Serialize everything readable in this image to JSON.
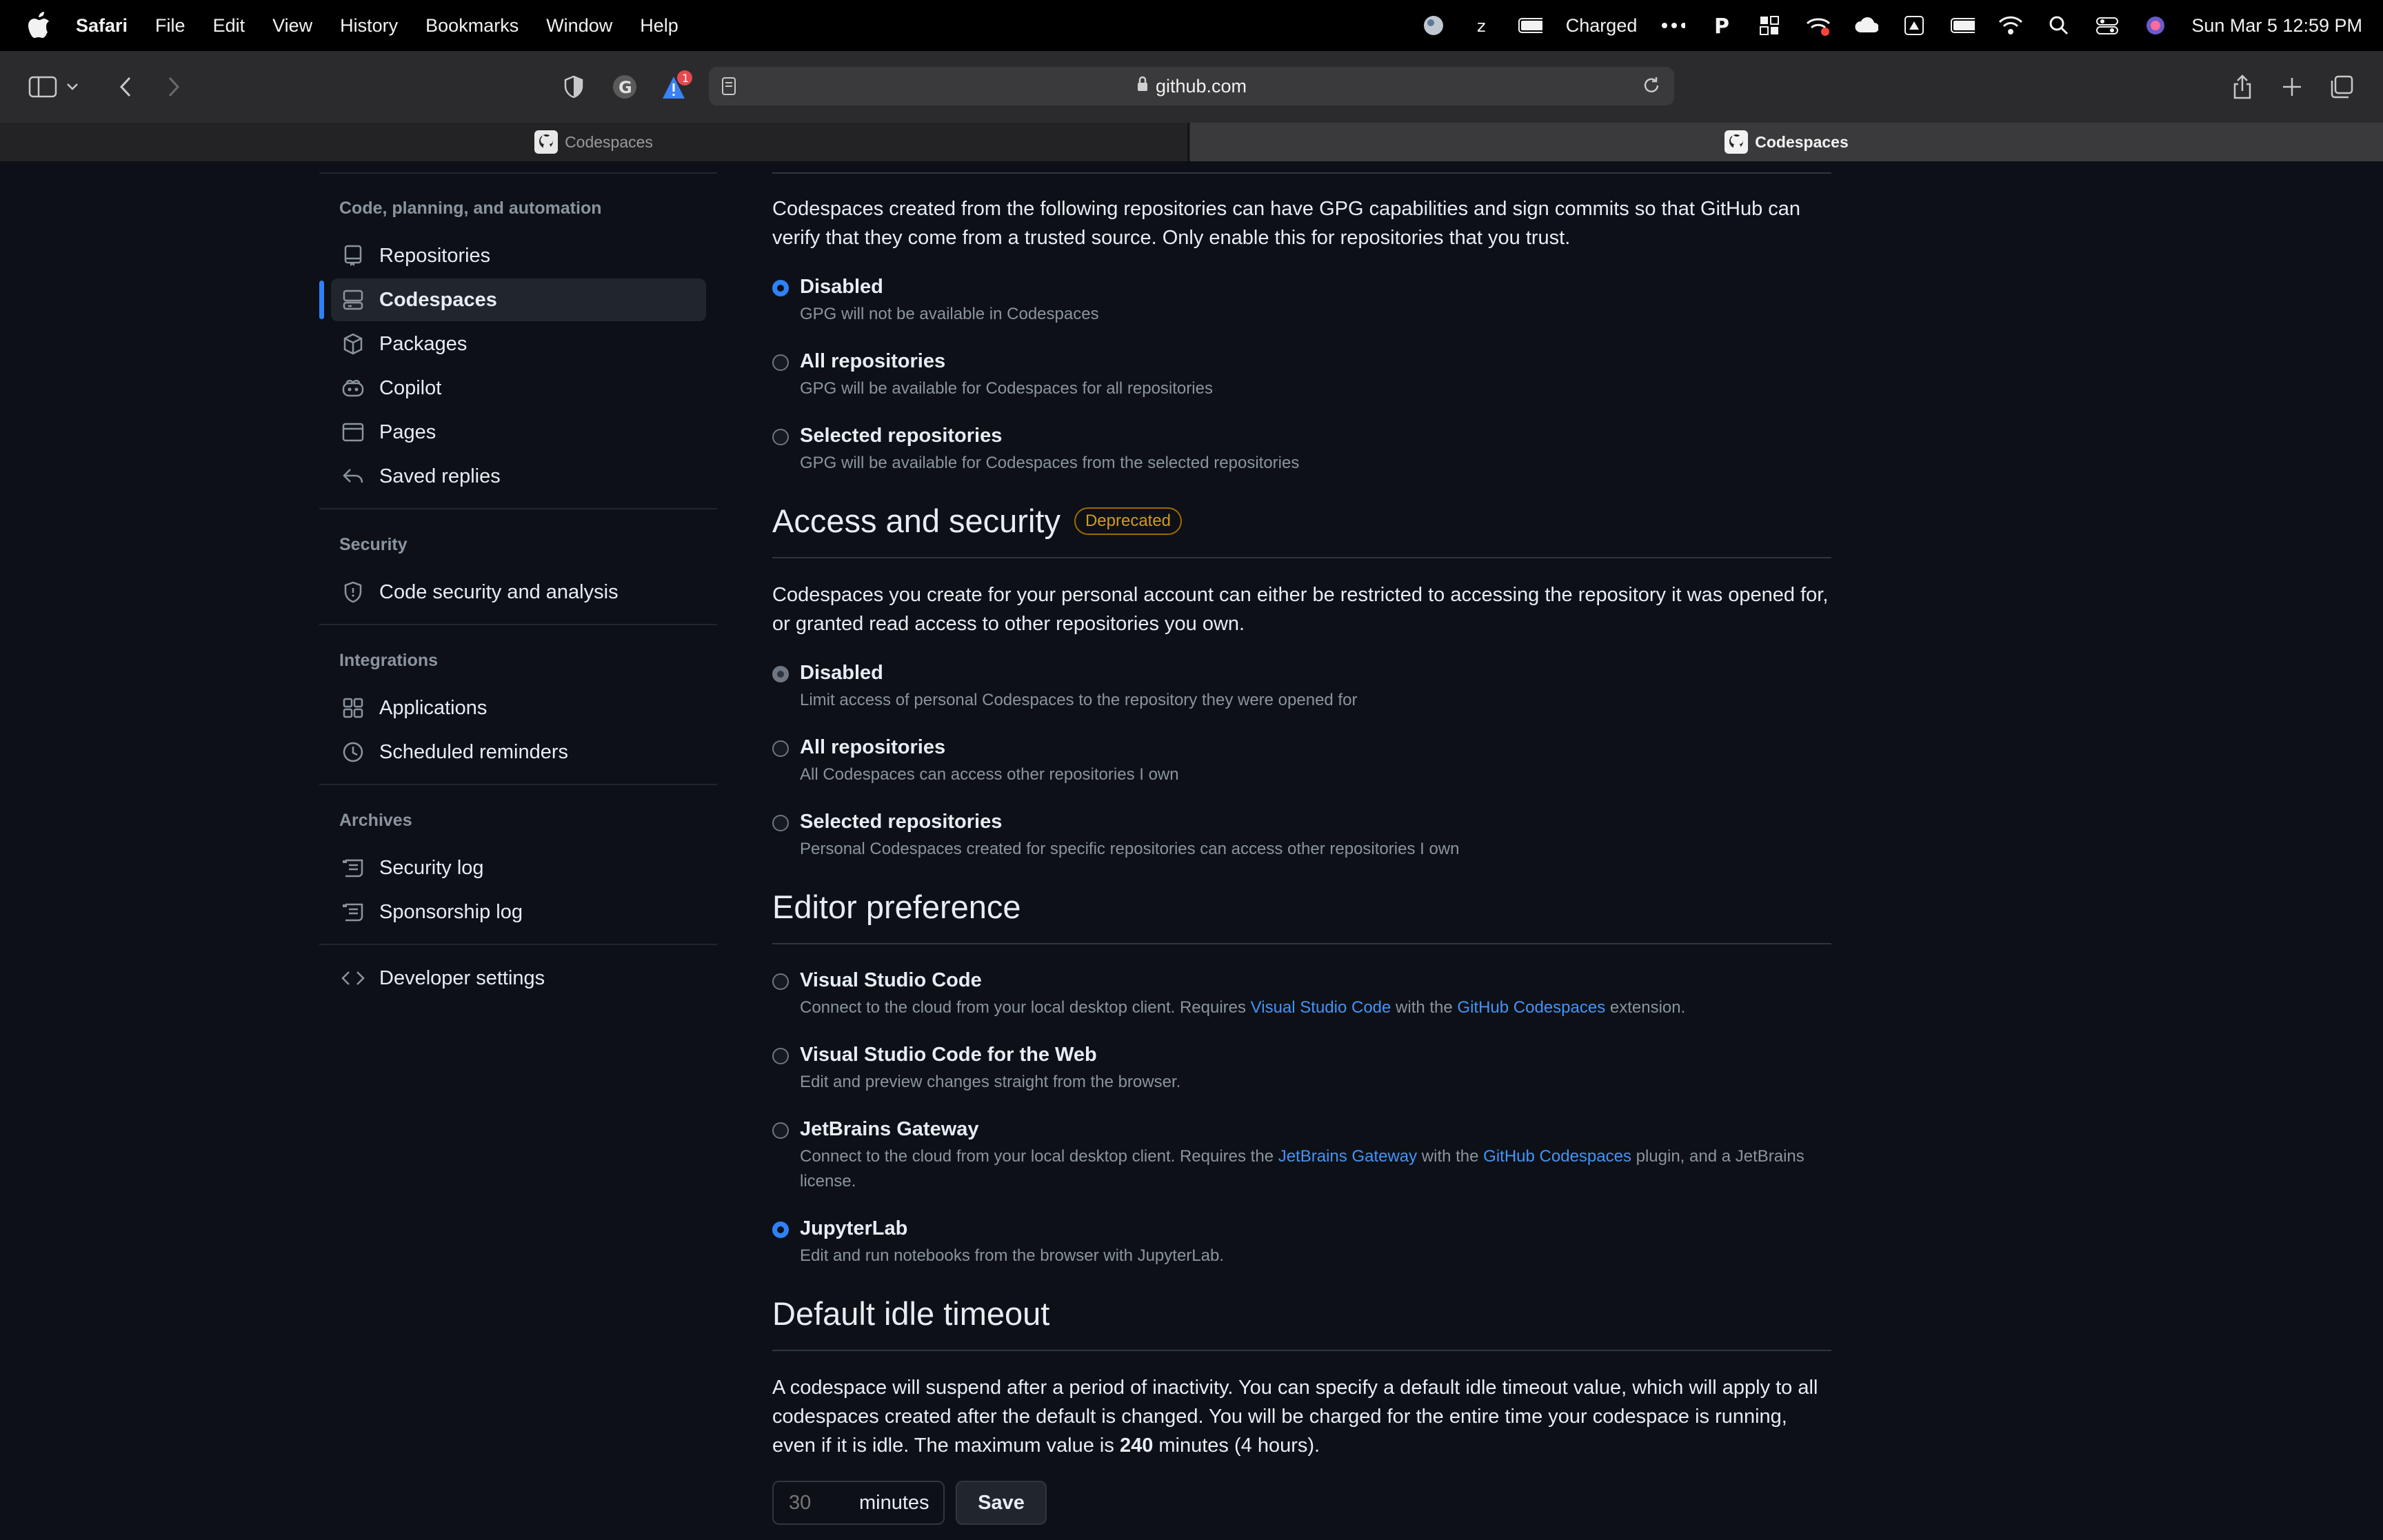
{
  "menubar": {
    "app": "Safari",
    "items": [
      "File",
      "Edit",
      "View",
      "History",
      "Bookmarks",
      "Window",
      "Help"
    ],
    "battery_label": "Charged",
    "datetime": "Sun Mar 5  12:59 PM"
  },
  "toolbar": {
    "url": "github.com",
    "badge_count": "1"
  },
  "tabs": [
    {
      "label": "Codespaces"
    },
    {
      "label": "Codespaces"
    }
  ],
  "sidebar": {
    "section_code": "Code, planning, and automation",
    "items_code": [
      {
        "label": "Repositories"
      },
      {
        "label": "Codespaces"
      },
      {
        "label": "Packages"
      },
      {
        "label": "Copilot"
      },
      {
        "label": "Pages"
      },
      {
        "label": "Saved replies"
      }
    ],
    "section_security": "Security",
    "items_security": [
      {
        "label": "Code security and analysis"
      }
    ],
    "section_integrations": "Integrations",
    "items_integrations": [
      {
        "label": "Applications"
      },
      {
        "label": "Scheduled reminders"
      }
    ],
    "section_archives": "Archives",
    "items_archives": [
      {
        "label": "Security log"
      },
      {
        "label": "Sponsorship log"
      }
    ],
    "developer_settings": "Developer settings"
  },
  "gpg": {
    "intro": "Codespaces created from the following repositories can have GPG capabilities and sign commits so that GitHub can verify that they come from a trusted source. Only enable this for repositories that you trust.",
    "options": [
      {
        "label": "Disabled",
        "desc": "GPG will not be available in Codespaces"
      },
      {
        "label": "All repositories",
        "desc": "GPG will be available for Codespaces for all repositories"
      },
      {
        "label": "Selected repositories",
        "desc": "GPG will be available for Codespaces from the selected repositories"
      }
    ]
  },
  "access": {
    "title": "Access and security",
    "badge": "Deprecated",
    "intro": "Codespaces you create for your personal account can either be restricted to accessing the repository it was opened for, or granted read access to other repositories you own.",
    "options": [
      {
        "label": "Disabled",
        "desc": "Limit access of personal Codespaces to the repository they were opened for"
      },
      {
        "label": "All repositories",
        "desc": "All Codespaces can access other repositories I own"
      },
      {
        "label": "Selected repositories",
        "desc": "Personal Codespaces created for specific repositories can access other repositories I own"
      }
    ]
  },
  "editor": {
    "title": "Editor preference",
    "options": [
      {
        "label": "Visual Studio Code",
        "desc_a": "Connect to the cloud from your local desktop client. Requires ",
        "link1": "Visual Studio Code",
        "desc_b": " with the ",
        "link2": "GitHub Codespaces",
        "desc_c": " extension."
      },
      {
        "label": "Visual Studio Code for the Web",
        "desc": "Edit and preview changes straight from the browser."
      },
      {
        "label": "JetBrains Gateway",
        "desc_a": "Connect to the cloud from your local desktop client. Requires the ",
        "link1": "JetBrains Gateway",
        "desc_b": " with the ",
        "link2": "GitHub Codespaces",
        "desc_c": " plugin, and a JetBrains license."
      },
      {
        "label": "JupyterLab",
        "desc": "Edit and run notebooks from the browser with JupyterLab."
      }
    ]
  },
  "timeout": {
    "title": "Default idle timeout",
    "desc_a": "A codespace will suspend after a period of inactivity. You can specify a default idle timeout value, which will apply to all codespaces created after the default is changed. You will be charged for the entire time your codespace is running, even if it is idle. The maximum value is ",
    "max": "240",
    "desc_b": " minutes (4 hours).",
    "placeholder": "30",
    "unit": "minutes",
    "save": "Save"
  },
  "colors": {
    "accent": "#2f81f7",
    "link": "#4493f8",
    "deprecated": "#d29922",
    "background": "#0d1117"
  }
}
